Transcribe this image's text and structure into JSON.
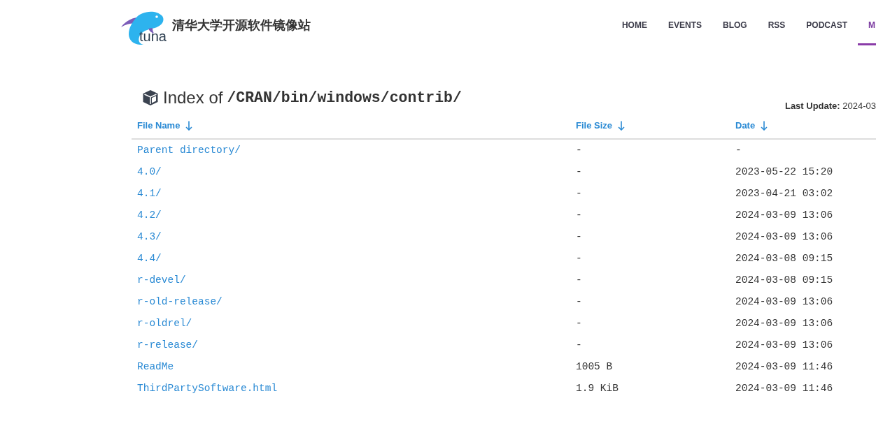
{
  "header": {
    "logo": {
      "text": "tuna"
    },
    "site_title": "清华大学开源软件镜像站",
    "nav": [
      {
        "label": "HOME",
        "selected": false
      },
      {
        "label": "EVENTS",
        "selected": false
      },
      {
        "label": "BLOG",
        "selected": false
      },
      {
        "label": "RSS",
        "selected": false
      },
      {
        "label": "PODCAST",
        "selected": false
      },
      {
        "label": "M",
        "selected": true
      }
    ]
  },
  "page": {
    "heading": {
      "prefix": "Index of",
      "path": "/CRAN/bin/windows/contrib/"
    },
    "last_update": "**Last Update:** 2024-03"
  },
  "table": {
    "columns": [
      "File Name",
      "File Size",
      "Date"
    ],
    "rows": [
      {
        "name": "Parent directory/",
        "size": "-",
        "date": "-"
      },
      {
        "name": "4.0/",
        "size": "-",
        "date": "2023-05-22 15:20"
      },
      {
        "name": "4.1/",
        "size": "-",
        "date": "2023-04-21 03:02"
      },
      {
        "name": "4.2/",
        "size": "-",
        "date": "2024-03-09 13:06"
      },
      {
        "name": "4.3/",
        "size": "-",
        "date": "2024-03-09 13:06"
      },
      {
        "name": "4.4/",
        "size": "-",
        "date": "2024-03-08 09:15"
      },
      {
        "name": "r-devel/",
        "size": "-",
        "date": "2024-03-08 09:15"
      },
      {
        "name": "r-old-release/",
        "size": "-",
        "date": "2024-03-09 13:06"
      },
      {
        "name": "r-oldrel/",
        "size": "-",
        "date": "2024-03-09 13:06"
      },
      {
        "name": "r-release/",
        "size": "-",
        "date": "2024-03-09 13:06"
      },
      {
        "name": "ReadMe",
        "size": "1005 B",
        "date": "2024-03-09 11:46"
      },
      {
        "name": "ThirdPartySoftware.html",
        "size": "1.9 KiB",
        "date": "2024-03-09 11:46"
      }
    ]
  }
}
